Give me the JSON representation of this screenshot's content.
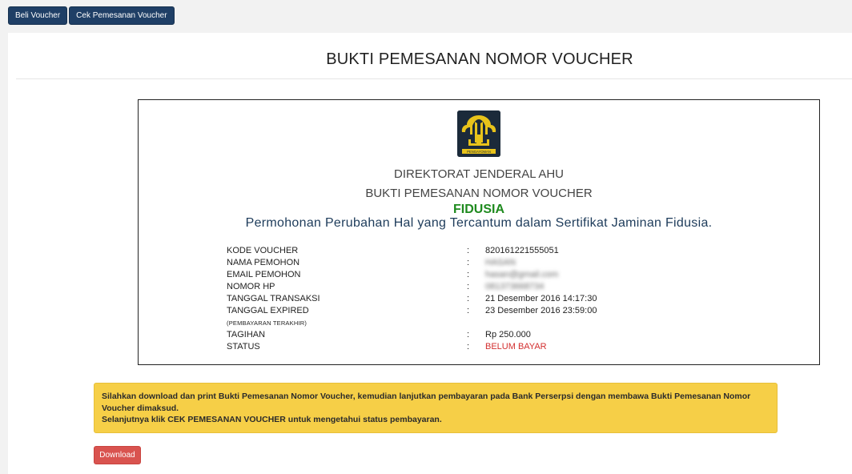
{
  "nav": {
    "beli_voucher": "Beli Voucher",
    "cek_pemesanan": "Cek Pemesanan Voucher"
  },
  "page_title": "BUKTI PEMESANAN NOMOR VOUCHER",
  "receipt": {
    "logo_text": "PENGAYOMAN",
    "org": "DIREKTORAT JENDERAL AHU",
    "doc_title": "BUKTI PEMESANAN NOMOR VOUCHER",
    "category": "FIDUSIA",
    "purpose": "Permohonan Perubahan Hal yang Tercantum dalam Sertifikat Jaminan Fidusia.",
    "fields": [
      {
        "label": "KODE VOUCHER",
        "value": "820161221555051"
      },
      {
        "label": "NAMA PEMOHON",
        "value": "HASAN"
      },
      {
        "label": "EMAIL PEMOHON",
        "value": "hasan@gmail.com"
      },
      {
        "label": "NOMOR HP",
        "value": "081373668734"
      },
      {
        "label": "TANGGAL TRANSAKSI",
        "value": "21 Desember 2016 14:17:30"
      },
      {
        "label": "TANGGAL EXPIRED",
        "value": "23 Desember 2016 23:59:00"
      },
      {
        "label": "(PEMBAYARAN TERAKHIR)"
      },
      {
        "label": "TAGIHAN",
        "value": "Rp 250.000"
      },
      {
        "label": "STATUS",
        "value": "BELUM BAYAR"
      }
    ],
    "colon": ":"
  },
  "alert": {
    "line1": "Silahkan download dan print Bukti Pemesanan Nomor Voucher, kemudian lanjutkan pembayaran pada Bank Perserpsi dengan membawa Bukti Pemesanan Nomor Voucher dimaksud.",
    "line2": "Selanjutnya klik CEK PEMESANAN VOUCHER untuk mengetahui status pembayaran."
  },
  "download_label": "Download",
  "colors": {
    "nav_button": "#1f3f66",
    "category_green": "#1e8a1e",
    "status_red": "#d32f2f",
    "alert_yellow": "#f6cf47",
    "download_red": "#d9534f"
  }
}
